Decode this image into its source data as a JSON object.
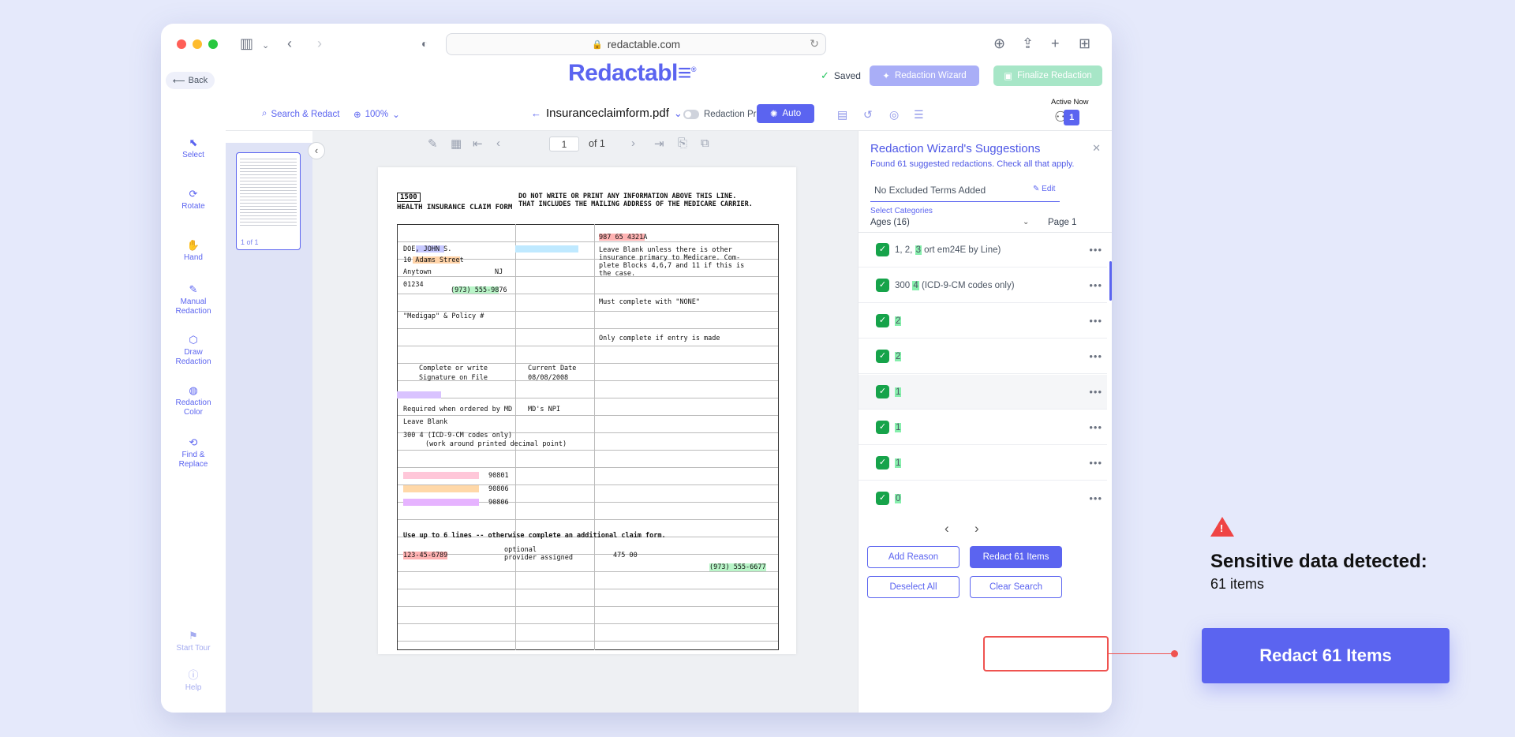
{
  "browser": {
    "url": "redactable.com"
  },
  "app": {
    "back": "Back",
    "logo": "Redactabl",
    "saved": "Saved",
    "wizard_btn": "Redaction Wizard",
    "finalize_btn": "Finalize Redaction",
    "active_now": "Active Now",
    "active_count": "1"
  },
  "toolbar": {
    "search": "Search & Redact",
    "zoom": "100%",
    "filename": "Insuranceclaimform.pdf",
    "preview": "Redaction Preview",
    "auto": "Auto"
  },
  "sidebar": {
    "items": [
      {
        "label": "Select"
      },
      {
        "label": "Rotate"
      },
      {
        "label": "Hand"
      },
      {
        "label": "Manual Redaction"
      },
      {
        "label": "Draw Redaction"
      },
      {
        "label": "Redaction Color"
      },
      {
        "label": "Find & Replace"
      },
      {
        "label": "Start Tour"
      },
      {
        "label": "Help"
      }
    ]
  },
  "thumbnail": {
    "label": "1 of 1"
  },
  "viewer": {
    "page": "1",
    "of": "of 1"
  },
  "document": {
    "form_number": "1500",
    "form_title": "HEALTH INSURANCE CLAIM FORM",
    "notice_line1": "DO NOT WRITE OR PRINT ANY INFORMATION ABOVE THIS LINE.",
    "notice_line2": "THAT INCLUDES THE MAILING ADDRESS OF THE MEDICARE CARRIER.",
    "fields": [
      "DOE, JOHN S.",
      "10 Adams Street",
      "Anytown",
      "NJ",
      "01234",
      "(973) 555-9876",
      "\"Medigap\" & Policy #",
      "Complete or write",
      "Signature on File",
      "Required when ordered by MD",
      "Leave Blank",
      "300 4 (ICD-9-CM codes only)",
      "(work around printed decimal point)",
      "987 65 4321A",
      "Leave Blank unless there is other",
      "insurance primary to Medicare. Com-",
      "plete Blocks 4,6,7 and 11 if this is",
      "the case.",
      "Must complete with \"NONE\"",
      "Only complete if entry is made",
      "Current Date",
      "08/08/2008",
      "MD's NPI",
      "90801",
      "90806",
      "90806",
      "123-45-6789",
      "optional",
      "provider assigned",
      "475 00",
      "(973) 555-6677",
      "Use up to 6 lines -- otherwise complete an additional claim form."
    ]
  },
  "panel": {
    "title": "Redaction Wizard's Suggestions",
    "subtitle": "Found 61 suggested redactions. Check all that apply.",
    "excluded": "No Excluded Terms Added",
    "edit": "Edit",
    "select_categories": "Select Categories",
    "category": "Ages (16)",
    "page": "Page 1",
    "suggestions": [
      {
        "pre": "1, 2, ",
        "hit": "3",
        "post": " ort em24E by Line)"
      },
      {
        "pre": "300 ",
        "hit": "4",
        "post": " (ICD-9-CM codes only)"
      },
      {
        "pre": "",
        "hit": "2",
        "post": ""
      },
      {
        "pre": "",
        "hit": "2",
        "post": ""
      },
      {
        "pre": "",
        "hit": "1",
        "post": ""
      },
      {
        "pre": "",
        "hit": "1",
        "post": ""
      },
      {
        "pre": "",
        "hit": "1",
        "post": ""
      },
      {
        "pre": "",
        "hit": "0",
        "post": ""
      }
    ],
    "add_reason": "Add Reason",
    "redact": "Redact 61 Items",
    "deselect": "Deselect All",
    "clear": "Clear Search"
  },
  "callout": {
    "title": "Sensitive data detected:",
    "count": "61 items",
    "button": "Redact 61 Items"
  },
  "colors": {
    "accent": "#5b64f0",
    "success": "#16a34a",
    "alert": "#ef4444"
  }
}
